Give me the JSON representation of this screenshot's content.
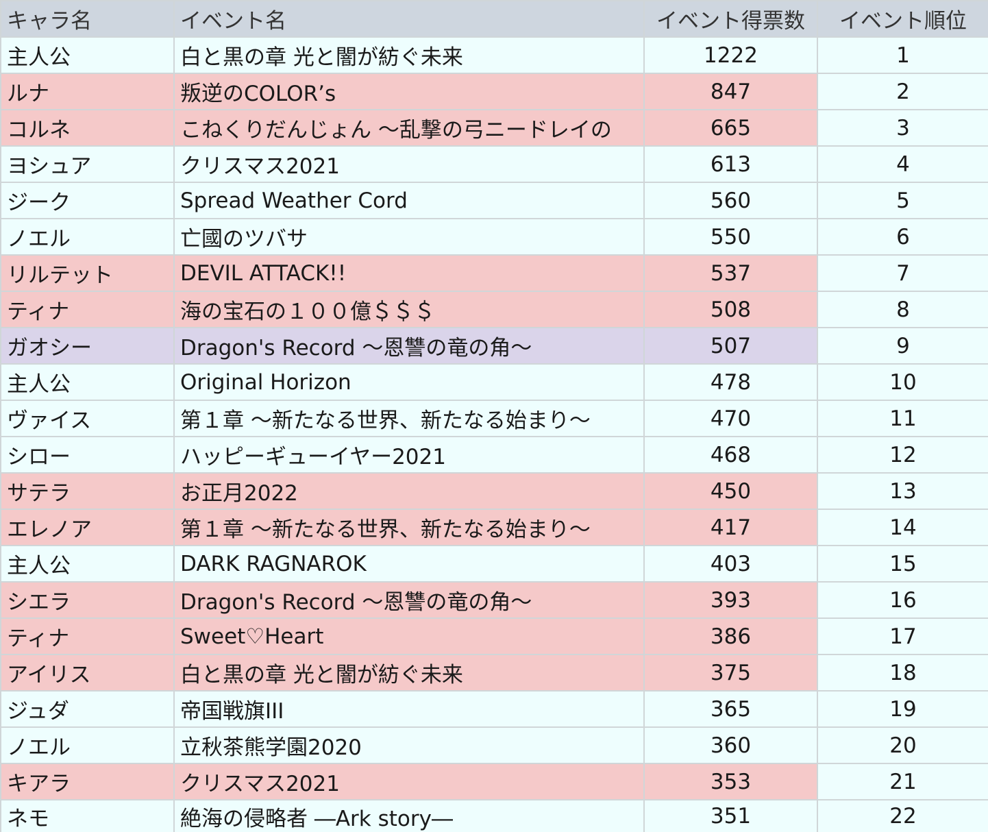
{
  "table": {
    "headers": {
      "name": "キャラ名",
      "event": "イベント名",
      "votes": "イベント得票数",
      "rank": "イベント順位"
    },
    "colors": {
      "header": "#ced6df",
      "row_default": "#eefefe",
      "row_pink": "#f5c9c9",
      "row_purple": "#dad4ea",
      "grid": "#d0d6d8"
    },
    "rows": [
      {
        "name": "主人公",
        "event": "白と黒の章 光と闇が紡ぐ未来",
        "votes": "1222",
        "rank": "1",
        "highlight": "none"
      },
      {
        "name": "ルナ",
        "event": "叛逆のCOLOR’s",
        "votes": "847",
        "rank": "2",
        "highlight": "pink"
      },
      {
        "name": "コルネ",
        "event": "こねくりだんじょん ～乱撃の弓ニードレイの",
        "votes": "665",
        "rank": "3",
        "highlight": "pink"
      },
      {
        "name": "ヨシュア",
        "event": "クリスマス2021",
        "votes": "613",
        "rank": "4",
        "highlight": "none"
      },
      {
        "name": "ジーク",
        "event": "Spread Weather Cord",
        "votes": "560",
        "rank": "5",
        "highlight": "none"
      },
      {
        "name": "ノエル",
        "event": "亡國のツバサ",
        "votes": "550",
        "rank": "6",
        "highlight": "none"
      },
      {
        "name": "リルテット",
        "event": "DEVIL ATTACK!!",
        "votes": "537",
        "rank": "7",
        "highlight": "pink"
      },
      {
        "name": "ティナ",
        "event": "海の宝石の１００億＄＄＄",
        "votes": "508",
        "rank": "8",
        "highlight": "pink"
      },
      {
        "name": "ガオシー",
        "event": "Dragon's Record ～恩讐の竜の角～",
        "votes": "507",
        "rank": "9",
        "highlight": "purple"
      },
      {
        "name": "主人公",
        "event": "Original Horizon",
        "votes": "478",
        "rank": "10",
        "highlight": "none"
      },
      {
        "name": "ヴァイス",
        "event": "第１章 ～新たなる世界、新たなる始まり～",
        "votes": "470",
        "rank": "11",
        "highlight": "none"
      },
      {
        "name": "シロー",
        "event": "ハッピーギューイヤー2021",
        "votes": "468",
        "rank": "12",
        "highlight": "none"
      },
      {
        "name": "サテラ",
        "event": "お正月2022",
        "votes": "450",
        "rank": "13",
        "highlight": "pink"
      },
      {
        "name": "エレノア",
        "event": "第１章 ～新たなる世界、新たなる始まり～",
        "votes": "417",
        "rank": "14",
        "highlight": "pink"
      },
      {
        "name": "主人公",
        "event": "DARK RAGNAROK",
        "votes": "403",
        "rank": "15",
        "highlight": "none"
      },
      {
        "name": "シエラ",
        "event": "Dragon's Record ～恩讐の竜の角～",
        "votes": "393",
        "rank": "16",
        "highlight": "pink"
      },
      {
        "name": "ティナ",
        "event": "Sweet♡Heart",
        "votes": "386",
        "rank": "17",
        "highlight": "pink"
      },
      {
        "name": "アイリス",
        "event": "白と黒の章 光と闇が紡ぐ未来",
        "votes": "375",
        "rank": "18",
        "highlight": "pink"
      },
      {
        "name": "ジュダ",
        "event": "帝国戦旗III",
        "votes": "365",
        "rank": "19",
        "highlight": "none"
      },
      {
        "name": "ノエル",
        "event": "立秋茶熊学園2020",
        "votes": "360",
        "rank": "20",
        "highlight": "none"
      },
      {
        "name": "キアラ",
        "event": "クリスマス2021",
        "votes": "353",
        "rank": "21",
        "highlight": "pink"
      },
      {
        "name": "ネモ",
        "event": "絶海の侵略者 ―Ark story―",
        "votes": "351",
        "rank": "22",
        "highlight": "none"
      }
    ]
  }
}
